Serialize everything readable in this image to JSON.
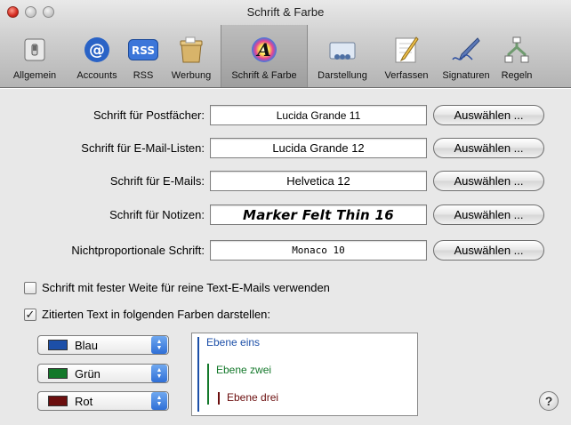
{
  "window": {
    "title": "Schrift & Farbe"
  },
  "toolbar": {
    "items": [
      {
        "label": "Allgemein",
        "icon": "switch-icon"
      },
      {
        "label": "Accounts",
        "icon": "at-sign-icon"
      },
      {
        "label": "RSS",
        "icon": "rss-icon"
      },
      {
        "label": "Werbung",
        "icon": "trash-bin-icon"
      },
      {
        "label": "Schrift & Farbe",
        "icon": "fonts-colors-icon",
        "selected": true
      },
      {
        "label": "Darstellung",
        "icon": "display-icon"
      },
      {
        "label": "Verfassen",
        "icon": "compose-pencil-icon"
      },
      {
        "label": "Signaturen",
        "icon": "signature-pen-icon"
      },
      {
        "label": "Regeln",
        "icon": "rules-icon"
      }
    ]
  },
  "fonts": [
    {
      "label": "Schrift für Postfächer:",
      "value": "Lucida Grande 11",
      "button": "Auswählen ..."
    },
    {
      "label": "Schrift für E-Mail-Listen:",
      "value": "Lucida Grande 12",
      "button": "Auswählen ..."
    },
    {
      "label": "Schrift für E-Mails:",
      "value": "Helvetica 12",
      "button": "Auswählen ..."
    },
    {
      "label": "Schrift für Notizen:",
      "value": "Marker Felt Thin 16",
      "button": "Auswählen ..."
    },
    {
      "label": "Nichtproportionale Schrift:",
      "value": "Monaco 10",
      "button": "Auswählen ..."
    }
  ],
  "options": {
    "fixed_width": {
      "label": "Schrift mit fester Weite für reine Text-E-Mails verwenden",
      "checked": false
    },
    "quote_colors": {
      "label": "Zitierten Text in folgenden Farben darstellen:",
      "checked": true
    }
  },
  "quote_levels": [
    {
      "color_name": "Blau",
      "color": "#1c4fa8",
      "preview_text": "Ebene eins"
    },
    {
      "color_name": "Grün",
      "color": "#13782a",
      "preview_text": "Ebene zwei"
    },
    {
      "color_name": "Rot",
      "color": "#6b0e0e",
      "preview_text": "Ebene drei"
    }
  ],
  "help": {
    "label": "?"
  }
}
